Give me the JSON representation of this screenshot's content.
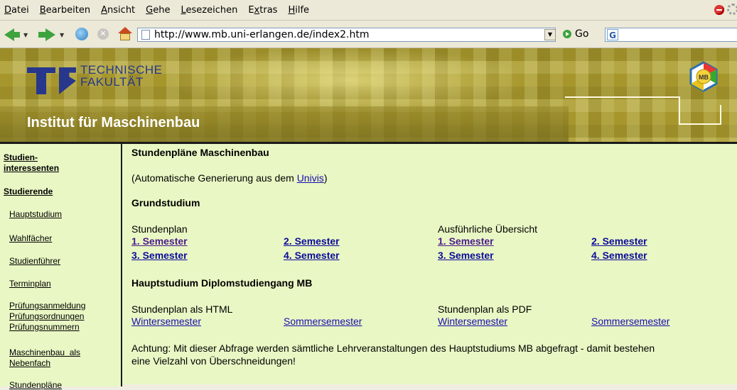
{
  "menubar": {
    "items": [
      {
        "label": "Datei",
        "key": "D"
      },
      {
        "label": "Bearbeiten",
        "key": "B"
      },
      {
        "label": "Ansicht",
        "key": "A"
      },
      {
        "label": "Gehe",
        "key": "G"
      },
      {
        "label": "Lesezeichen",
        "key": "L"
      },
      {
        "label": "Extras",
        "key": "x"
      },
      {
        "label": "Hilfe",
        "key": "H"
      }
    ]
  },
  "toolbar": {
    "url": "http://www.mb.uni-erlangen.de/index2.htm",
    "go_label": "Go",
    "search_engine_letter": "G"
  },
  "banner": {
    "logo_line1": "TECHNISCHE",
    "logo_line2": "FAKULTÄT",
    "institute": "Institut für Maschinenbau",
    "badge": "MB"
  },
  "sidebar": {
    "items": [
      "Studien-",
      "interessenten",
      "Studierende",
      "Hauptstudium",
      "Wahlfächer",
      "Studienführer",
      "Terminplan",
      "Prüfungsanmeldung",
      "Prüfungsordnungen",
      "Prüfungsnummern",
      "Maschinenbau  als",
      "Nebenfach",
      "Stundenpläne"
    ]
  },
  "main": {
    "title": "Stundenpläne Maschinenbau",
    "auto_prefix": "(Automatische Generierung aus dem ",
    "auto_link": "Univis",
    "auto_suffix": ")",
    "grund_heading": "Grundstudium",
    "stundenplan_label": "Stundenplan",
    "uebersicht_label": "Ausführliche Übersicht",
    "sem1": "1. Semester",
    "sem2": "2. Semester",
    "sem3": "3. Semester",
    "sem4": "4. Semester",
    "haupt_heading": "Hauptstudium Diplomstudiengang MB",
    "html_label": "Stundenplan als HTML",
    "pdf_label": "Stundenplan als PDF",
    "winter": "Wintersemester",
    "sommer": "Sommersemester",
    "note_line1": "Achtung: Mit dieser Abfrage werden sämtliche Lehrveranstaltungen des Hauptstudiums MB abgefragt - damit bestehen",
    "note_line2": "eine Vielzahl von Überschneidungen!"
  }
}
